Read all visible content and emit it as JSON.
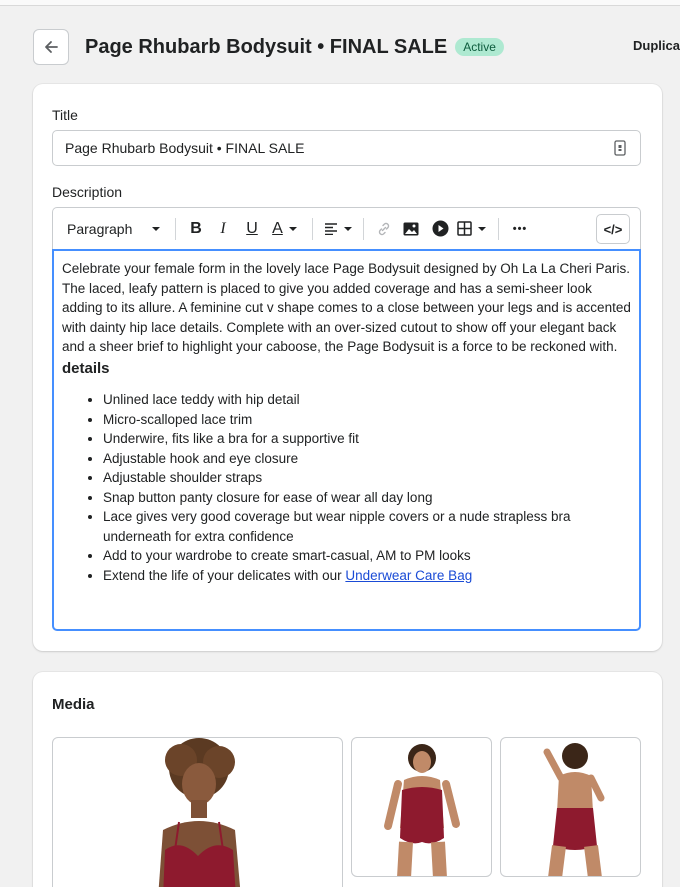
{
  "header": {
    "title": "Page Rhubarb Bodysuit • FINAL SALE",
    "status": "Active",
    "duplicate_label": "Duplica"
  },
  "form": {
    "title_label": "Title",
    "title_value": "Page Rhubarb Bodysuit • FINAL SALE",
    "description_label": "Description"
  },
  "toolbar": {
    "paragraph_label": "Paragraph",
    "bold": "B",
    "italic": "I",
    "underline": "U",
    "color": "A",
    "more": "•••",
    "code": "</>"
  },
  "description": {
    "intro": "Celebrate your female form in the lovely lace Page Bodysuit designed by Oh La La Cheri Paris. The laced, leafy pattern is placed to give you added coverage and has a semi-sheer look adding to its allure. A feminine cut v shape comes to a close between your legs and is accented with dainty hip lace details. Complete with an over-sized cutout to show off your elegant back and a sheer brief to highlight your caboose, the Page Bodysuit is a force to be reckoned with.",
    "details_heading": "details",
    "bullets": [
      "Unlined lace teddy with hip detail",
      "Micro-scalloped lace trim",
      "Underwire, fits like a bra for a supportive fit",
      "Adjustable hook and eye closure",
      "Adjustable shoulder straps",
      "Snap button panty closure for ease of wear all day long",
      "Lace gives very good coverage but wear nipple covers or a nude strapless bra underneath for extra confidence",
      "Add to your wardrobe to create smart-casual, AM to PM looks"
    ],
    "last_bullet_prefix": "Extend the life of your delicates with our ",
    "last_bullet_link": "Underwear Care Bag"
  },
  "media": {
    "title": "Media"
  },
  "colors": {
    "badge_bg": "#aee9d1",
    "focus_border": "#458fff",
    "link": "#1a4bd6",
    "product": "#8e1a2e"
  }
}
